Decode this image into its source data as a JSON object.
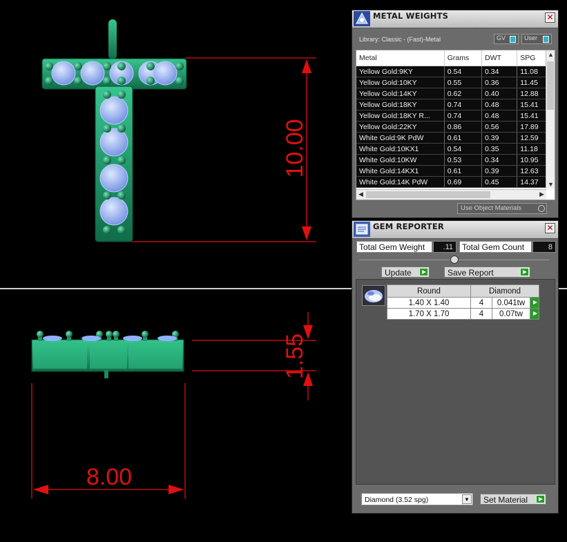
{
  "drawing": {
    "dim_height_top": "10.00",
    "dim_height_side": "1.55",
    "dim_width": "8.00",
    "dim_color": "#e01010"
  },
  "metal_weights": {
    "title": "METAL WEIGHTS",
    "library": "Library: Classic - (Fast)-Metal",
    "toggle_gv": "GV",
    "toggle_user": "User",
    "columns": [
      "Metal",
      "Grams",
      "DWT",
      "SPG"
    ],
    "rows": [
      [
        "Yellow Gold:9KY",
        "0.54",
        "0.34",
        "11.08"
      ],
      [
        "Yellow Gold:10KY",
        "0.55",
        "0.36",
        "11.45"
      ],
      [
        "Yellow Gold:14KY",
        "0.62",
        "0.40",
        "12.88"
      ],
      [
        "Yellow Gold:18KY",
        "0.74",
        "0.48",
        "15.41"
      ],
      [
        "Yellow Gold:18KY R...",
        "0.74",
        "0.48",
        "15.41"
      ],
      [
        "Yellow Gold:22KY",
        "0.86",
        "0.56",
        "17.89"
      ],
      [
        "White Gold:9K PdW",
        "0.61",
        "0.39",
        "12.59"
      ],
      [
        "White Gold:10KX1",
        "0.54",
        "0.35",
        "11.18"
      ],
      [
        "White Gold:10KW",
        "0.53",
        "0.34",
        "10.95"
      ],
      [
        "White Gold:14KX1",
        "0.61",
        "0.39",
        "12.63"
      ],
      [
        "White Gold:14K PdW",
        "0.69",
        "0.45",
        "14.37"
      ]
    ],
    "use_object_materials": "Use Object Materials"
  },
  "gem_reporter": {
    "title": "GEM REPORTER",
    "total_weight_label": "Total Gem Weight",
    "total_weight_value": ".11",
    "total_count_label": "Total Gem Count",
    "total_count_value": "8",
    "update_label": "Update",
    "save_report_label": "Save Report",
    "table_headers": [
      "Round",
      "Diamond"
    ],
    "gems": [
      {
        "size": "1.40 X 1.40",
        "count": "4",
        "weight": "0.041tw"
      },
      {
        "size": "1.70 X 1.70",
        "count": "4",
        "weight": "0.07tw"
      }
    ],
    "material_select": "Diamond     (3.52 spg)",
    "set_material_label": "Set Material"
  },
  "icons": [
    "metal-weights-icon",
    "gem-reporter-icon",
    "close-icon",
    "gem-thumbnail-icon",
    "go-arrow-icon",
    "chevron-down-icon"
  ],
  "colors": {
    "jewel_green": "#1f9a6a",
    "gem_blue": "#8fb2ff",
    "accent_green": "#2a9a2a"
  }
}
